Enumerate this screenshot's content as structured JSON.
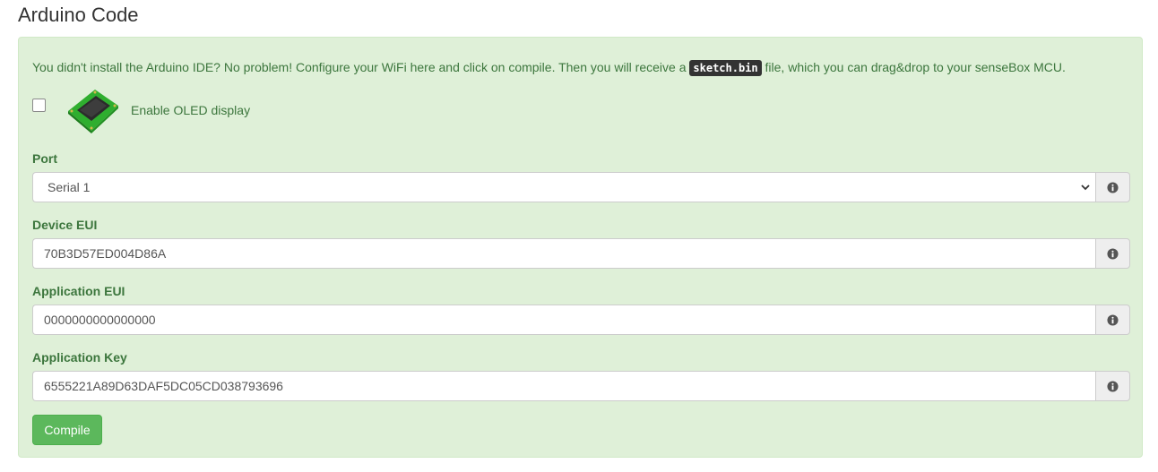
{
  "page_title": "Arduino Code",
  "intro": {
    "text_before": "You didn't install the Arduino IDE? No problem! Configure your WiFi here and click on compile. Then you will receive a",
    "filename": "sketch.bin",
    "text_after": "file, which you can drag&drop to your senseBox MCU."
  },
  "oled": {
    "checked": false,
    "label": "Enable OLED display",
    "image_icon": "oled-display-image"
  },
  "fields": {
    "port": {
      "label": "Port",
      "value": "Serial 1",
      "addon_icon": "info-icon"
    },
    "device_eui": {
      "label": "Device EUI",
      "value": "70B3D57ED004D86A",
      "addon_icon": "info-icon"
    },
    "app_eui": {
      "label": "Application EUI",
      "value": "0000000000000000",
      "addon_icon": "info-icon"
    },
    "app_key": {
      "label": "Application Key",
      "value": "6555221A89D63DAF5DC05CD038793696",
      "addon_icon": "info-icon"
    }
  },
  "compile_button": {
    "label": "Compile"
  },
  "colors": {
    "panel_bg": "#dff0d8",
    "text_green": "#3c763d",
    "button_green": "#5cb85c"
  }
}
